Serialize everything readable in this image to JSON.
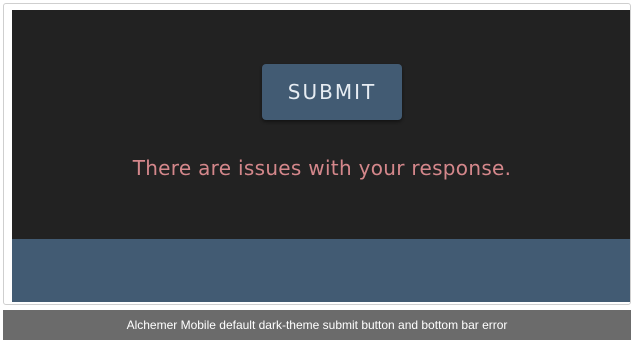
{
  "survey": {
    "submit_label": "SUBMIT",
    "error_message": "There are issues with your response."
  },
  "caption": {
    "text": "Alchemer Mobile default dark-theme submit button and bottom bar error"
  },
  "colors": {
    "background": "#222222",
    "accent": "#425b73",
    "error_text": "#d4878b",
    "button_text": "#e6ecf2",
    "caption_background": "#6b6b6b"
  }
}
